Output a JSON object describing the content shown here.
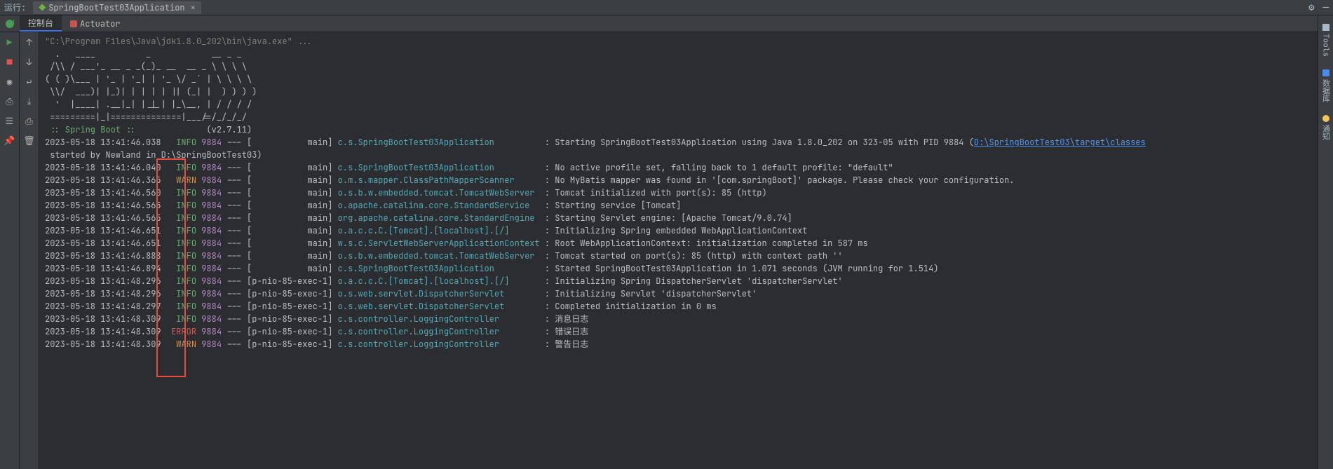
{
  "topbar": {
    "run_label": "运行:",
    "run_config": "SpringBootTest03Application",
    "close_glyph": "×"
  },
  "tabs": {
    "console": "控制台",
    "actuator": "Actuator"
  },
  "right_tabs": {
    "tools": "Tools",
    "database": "数据库",
    "tips": "通知"
  },
  "icons": {
    "rerun": "↻",
    "stop": "■",
    "play": "▶",
    "camera": "◉",
    "print": "⎙",
    "layout": "☰",
    "trash": "🗑",
    "pin": "📌",
    "up": "↑",
    "down": "↓",
    "wrap": "↩",
    "scroll": "⤓",
    "gear": "⚙",
    "minus": "—"
  },
  "cmd": "\"C:\\Program Files\\Java\\jdk1.8.0_202\\bin\\java.exe\" ...",
  "banner": [
    "  .   ____          _            __ _ _",
    " /\\\\ / ___'_ __ _ _(_)_ __  __ _ \\ \\ \\ \\",
    "( ( )\\___ | '_ | '_| | '_ \\/ _` | \\ \\ \\ \\",
    " \\\\/  ___)| |_)| | | | | || (_| |  ) ) ) )",
    "  '  |____| .__|_| |_|_| |_\\__, | / / / /",
    " =========|_|==============|___/=/_/_/_/"
  ],
  "spring_label": " :: Spring Boot :: ",
  "spring_version": "             (v2.7.11)",
  "log_link": "D:\\SpringBootTest03\\target\\classes",
  "log": [
    {
      "ts": "2023-05-18 13:41:46.038",
      "level": "INFO",
      "pid": "9884",
      "thread": "           main",
      "logger": "c.s.SpringBootTest03Application         ",
      "msg": "Starting SpringBootTest03Application using Java 1.8.0_202 on 323-05 with PID 9884 (",
      "link": true
    },
    {
      "cont": " started by Newland in D:\\SpringBootTest03)"
    },
    {
      "ts": "2023-05-18 13:41:46.040",
      "level": "INFO",
      "pid": "9884",
      "thread": "           main",
      "logger": "c.s.SpringBootTest03Application         ",
      "msg": "No active profile set, falling back to 1 default profile: \"default\""
    },
    {
      "ts": "2023-05-18 13:41:46.365",
      "level": "WARN",
      "pid": "9884",
      "thread": "           main",
      "logger": "o.m.s.mapper.ClassPathMapperScanner     ",
      "msg": "No MyBatis mapper was found in '[com.springBoot]' package. Please check your configuration."
    },
    {
      "ts": "2023-05-18 13:41:46.560",
      "level": "INFO",
      "pid": "9884",
      "thread": "           main",
      "logger": "o.s.b.w.embedded.tomcat.TomcatWebServer ",
      "msg": "Tomcat initialized with port(s): 85 (http)"
    },
    {
      "ts": "2023-05-18 13:41:46.565",
      "level": "INFO",
      "pid": "9884",
      "thread": "           main",
      "logger": "o.apache.catalina.core.StandardService  ",
      "msg": "Starting service [Tomcat]"
    },
    {
      "ts": "2023-05-18 13:41:46.565",
      "level": "INFO",
      "pid": "9884",
      "thread": "           main",
      "logger": "org.apache.catalina.core.StandardEngine ",
      "msg": "Starting Servlet engine: [Apache Tomcat/9.0.74]"
    },
    {
      "ts": "2023-05-18 13:41:46.651",
      "level": "INFO",
      "pid": "9884",
      "thread": "           main",
      "logger": "o.a.c.c.C.[Tomcat].[localhost].[/]      ",
      "msg": "Initializing Spring embedded WebApplicationContext"
    },
    {
      "ts": "2023-05-18 13:41:46.651",
      "level": "INFO",
      "pid": "9884",
      "thread": "           main",
      "logger": "w.s.c.ServletWebServerApplicationContext",
      "msg": "Root WebApplicationContext: initialization completed in 587 ms"
    },
    {
      "ts": "2023-05-18 13:41:46.888",
      "level": "INFO",
      "pid": "9884",
      "thread": "           main",
      "logger": "o.s.b.w.embedded.tomcat.TomcatWebServer ",
      "msg": "Tomcat started on port(s): 85 (http) with context path ''"
    },
    {
      "ts": "2023-05-18 13:41:46.894",
      "level": "INFO",
      "pid": "9884",
      "thread": "           main",
      "logger": "c.s.SpringBootTest03Application         ",
      "msg": "Started SpringBootTest03Application in 1.071 seconds (JVM running for 1.514)"
    },
    {
      "ts": "2023-05-18 13:41:48.296",
      "level": "INFO",
      "pid": "9884",
      "thread": "p-nio-85-exec-1",
      "logger": "o.a.c.c.C.[Tomcat].[localhost].[/]      ",
      "msg": "Initializing Spring DispatcherServlet 'dispatcherServlet'"
    },
    {
      "ts": "2023-05-18 13:41:48.296",
      "level": "INFO",
      "pid": "9884",
      "thread": "p-nio-85-exec-1",
      "logger": "o.s.web.servlet.DispatcherServlet       ",
      "msg": "Initializing Servlet 'dispatcherServlet'"
    },
    {
      "ts": "2023-05-18 13:41:48.297",
      "level": "INFO",
      "pid": "9884",
      "thread": "p-nio-85-exec-1",
      "logger": "o.s.web.servlet.DispatcherServlet       ",
      "msg": "Completed initialization in 0 ms"
    },
    {
      "ts": "2023-05-18 13:41:48.309",
      "level": "INFO",
      "pid": "9884",
      "thread": "p-nio-85-exec-1",
      "logger": "c.s.controller.LoggingController        ",
      "msg": "消息日志"
    },
    {
      "ts": "2023-05-18 13:41:48.309",
      "level": "ERROR",
      "pid": "9884",
      "thread": "p-nio-85-exec-1",
      "logger": "c.s.controller.LoggingController        ",
      "msg": "错误日志"
    },
    {
      "ts": "2023-05-18 13:41:48.309",
      "level": "WARN",
      "pid": "9884",
      "thread": "p-nio-85-exec-1",
      "logger": "c.s.controller.LoggingController        ",
      "msg": "警告日志"
    }
  ]
}
